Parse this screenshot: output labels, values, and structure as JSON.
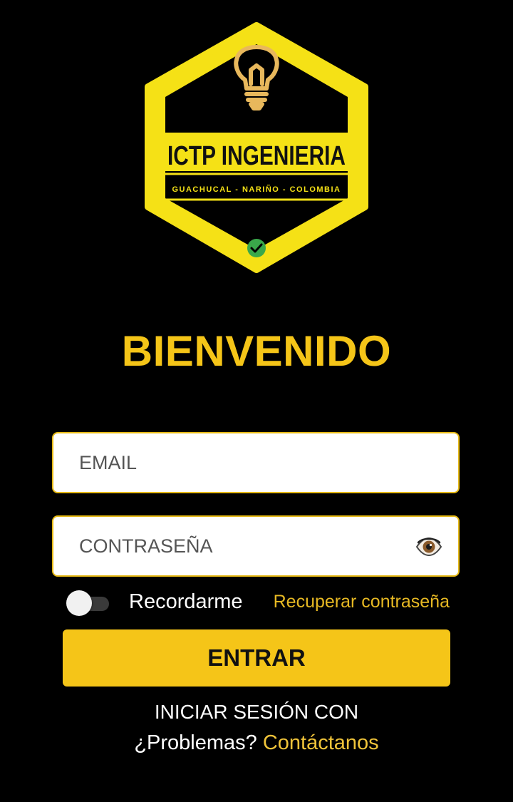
{
  "logo": {
    "title": "ICTP INGENIERIA",
    "subtitle": "GUACHUCAL - NARIÑO - COLOMBIA",
    "icons": [
      "lightbulb-icon",
      "check-circle-icon"
    ],
    "colors": {
      "frame": "#f5e116",
      "check": "#3aa84a"
    }
  },
  "welcome": "BIENVENIDO",
  "form": {
    "email_placeholder": "EMAIL",
    "email_value": "",
    "password_placeholder": "CONTRASEÑA",
    "password_value": "",
    "show_password_icon": "eye-icon",
    "remember_label": "Recordarme",
    "remember_on": false,
    "recover_label": "Recuperar contraseña"
  },
  "enter_button": "ENTRAR",
  "login_with": "INICIAR SESIÓN CON",
  "footer": {
    "question": "¿Problemas?",
    "contact": "Contáctanos"
  },
  "colors": {
    "background": "#000000",
    "accent": "#f5c518",
    "link": "#e7b923"
  }
}
